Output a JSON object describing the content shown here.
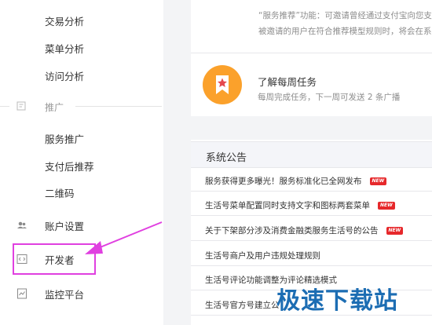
{
  "sidebar": {
    "items_top": [
      {
        "label": "交易分析"
      },
      {
        "label": "菜单分析"
      },
      {
        "label": "访问分析"
      }
    ],
    "section": {
      "label": "推广",
      "icon": "promote-icon"
    },
    "items_promote": [
      {
        "label": "服务推广"
      },
      {
        "label": "支付后推荐"
      },
      {
        "label": "二维码"
      }
    ],
    "account": {
      "label": "账户设置",
      "icon": "users-icon"
    },
    "developer": {
      "label": "开发者",
      "icon": "code-icon"
    },
    "monitor": {
      "label": "监控平台",
      "icon": "monitor-icon"
    }
  },
  "intro": {
    "line1": "“服务推荐”功能：可邀请曾经通过支付宝向您支",
    "line2": "被邀请的用户在符合推荐模型规则时，将会在系"
  },
  "task": {
    "title": "了解每周任务",
    "subtitle": "每周完成任务，下一周可发送 2 条广播",
    "badge_color": "#fba12b"
  },
  "notices": {
    "title": "系统公告",
    "new_label": "NEW",
    "rows": [
      {
        "text": "服务获得更多曝光！服务标准化已全网发布",
        "is_new": true
      },
      {
        "text": "生活号菜单配置同时支持文字和图标两套菜单",
        "is_new": true
      },
      {
        "text": "关于下架部分涉及消费金融类服务生活号的公告",
        "is_new": true
      },
      {
        "text": "生活号商户及用户违规处理规则",
        "is_new": false
      },
      {
        "text": "生活号评论功能调整为评论精选模式",
        "is_new": false
      },
      {
        "text": "生活号官方号建立公",
        "is_new": false
      }
    ]
  },
  "annotation": {
    "color": "#e040e0"
  },
  "watermark": {
    "text": "极速下载站"
  }
}
